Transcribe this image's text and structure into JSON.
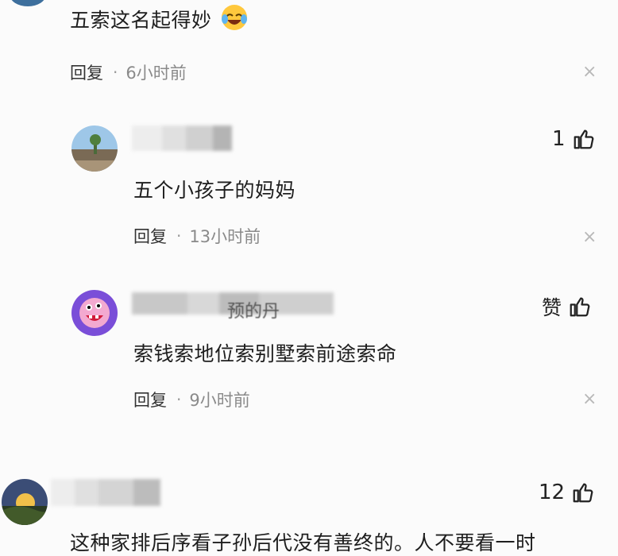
{
  "top_comment": {
    "text": "五索这名起得妙",
    "emoji_icon": "laughing-crying-emoji",
    "reply_label": "回复",
    "time": "6小时前",
    "close_glyph": "×"
  },
  "replies": [
    {
      "text": "五个小孩子的妈妈",
      "likes": "1",
      "reply_label": "回复",
      "time": "13小时前",
      "close_glyph": "×"
    },
    {
      "name_partial": "预的丹",
      "text": "索钱索地位索别墅索前途索命",
      "likes": "赞",
      "reply_label": "回复",
      "time": "9小时前",
      "close_glyph": "×"
    }
  ],
  "bottom_comment": {
    "text": "这种家排后序看子孙后代没有善终的。人不要看一时",
    "likes": "12"
  },
  "icons": {
    "like": "thumbs-up-icon",
    "close": "close-icon"
  },
  "colors": {
    "background": "#fbfbfb",
    "meta_gray": "#8a8a8a",
    "close_gray": "#b8b8b8",
    "avatar_purple": "#7a4ed8"
  }
}
